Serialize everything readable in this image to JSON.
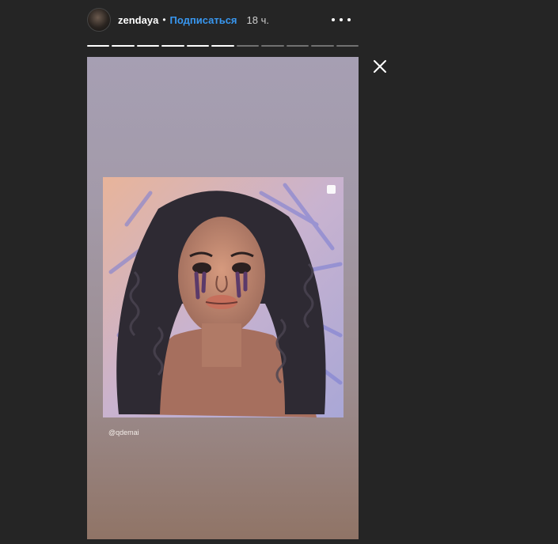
{
  "header": {
    "username": "zendaya",
    "separator": "•",
    "follow_label": "Подписаться",
    "time": "18 ч."
  },
  "story": {
    "total_segments": 11,
    "completed_segments": 6,
    "mention": "@qdemai"
  },
  "icons": {
    "more": "more-horizontal-icon",
    "close": "close-icon"
  },
  "colors": {
    "background": "#252525",
    "follow": "#3897f0"
  }
}
